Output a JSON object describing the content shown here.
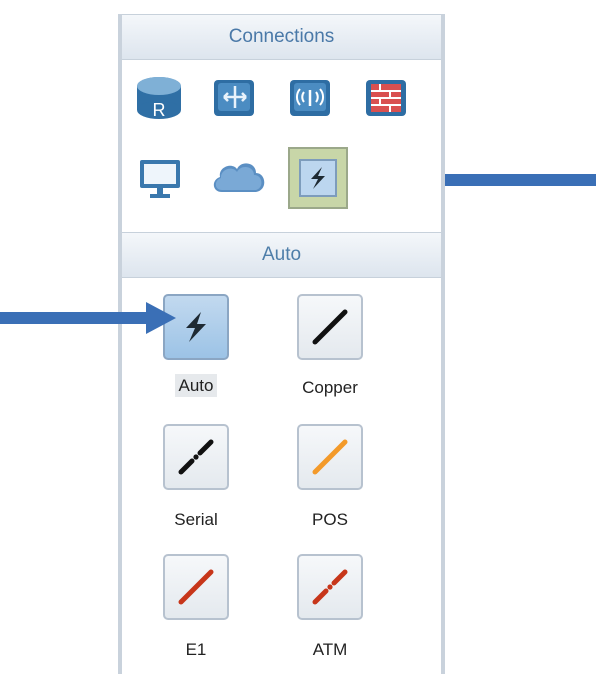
{
  "panel": {
    "connections_title": "Connections",
    "auto_title": "Auto"
  },
  "devices": [
    {
      "icon": "router-icon",
      "label_letter": "R"
    },
    {
      "icon": "switch-icon"
    },
    {
      "icon": "wireless-ap-icon"
    },
    {
      "icon": "firewall-icon"
    },
    {
      "icon": "pc-monitor-icon"
    },
    {
      "icon": "cloud-icon"
    },
    {
      "icon": "connection-auto-icon",
      "selected": true
    }
  ],
  "cables": [
    {
      "label": "Auto",
      "icon": "lightning-icon",
      "color": "#1e2a33",
      "selected": true
    },
    {
      "label": "Copper",
      "icon": "copper-cable-icon",
      "color": "#111111"
    },
    {
      "label": "Serial",
      "icon": "serial-cable-icon",
      "color": "#111111"
    },
    {
      "label": "POS",
      "icon": "pos-cable-icon",
      "color": "#f39a2a"
    },
    {
      "label": "E1",
      "icon": "e1-cable-icon",
      "color": "#c7361a"
    },
    {
      "label": "ATM",
      "icon": "atm-cable-icon",
      "color": "#c7361a"
    }
  ],
  "colors": {
    "header_text": "#4a79a8",
    "arrow": "#3a6fb6"
  }
}
